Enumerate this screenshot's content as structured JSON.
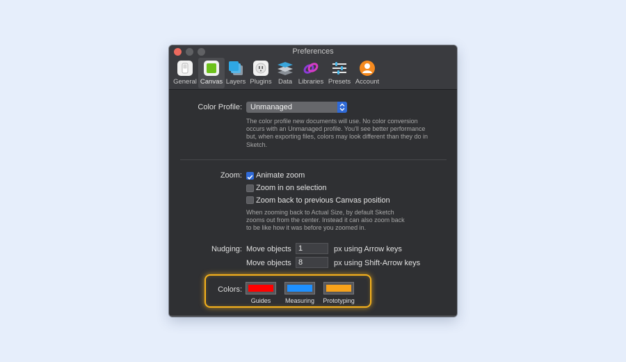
{
  "window": {
    "title": "Preferences"
  },
  "tabs": [
    {
      "label": "General",
      "icon": "general-switch-icon"
    },
    {
      "label": "Canvas",
      "icon": "canvas-square-icon"
    },
    {
      "label": "Layers",
      "icon": "layers-stack-icon"
    },
    {
      "label": "Plugins",
      "icon": "plugin-plug-icon"
    },
    {
      "label": "Data",
      "icon": "data-stack-icon"
    },
    {
      "label": "Libraries",
      "icon": "libraries-link-icon"
    },
    {
      "label": "Presets",
      "icon": "presets-sliders-icon"
    },
    {
      "label": "Account",
      "icon": "account-user-icon"
    }
  ],
  "active_tab": "Canvas",
  "color_profile": {
    "label": "Color Profile:",
    "value": "Unmanaged",
    "help": [
      "The color profile new documents will use. No color conversion",
      "occurs with an Unmanaged profile. You'll see better performance",
      "but, when exporting files, colors may look different than they do in",
      "Sketch."
    ]
  },
  "zoom": {
    "label": "Zoom:",
    "options": [
      {
        "label": "Animate zoom",
        "checked": true
      },
      {
        "label": "Zoom in on selection",
        "checked": false
      },
      {
        "label": "Zoom back to previous Canvas position",
        "checked": false
      }
    ],
    "help": [
      "When zooming back to Actual Size, by default Sketch",
      "zooms out from the center. Instead it can also zoom back",
      "to be like how it was before you zoomed in."
    ]
  },
  "nudging": {
    "label": "Nudging:",
    "rows": [
      {
        "prefix": "Move objects",
        "value": "1",
        "suffix": "px using Arrow keys"
      },
      {
        "prefix": "Move objects",
        "value": "8",
        "suffix": "px using Shift-Arrow keys"
      }
    ]
  },
  "colors": {
    "label": "Colors:",
    "wells": [
      {
        "label": "Guides",
        "color": "#ff0000"
      },
      {
        "label": "Measuring",
        "color": "#1e90ff"
      },
      {
        "label": "Prototyping",
        "color": "#f7a21b"
      }
    ],
    "highlight_color": "#f6b21c"
  }
}
